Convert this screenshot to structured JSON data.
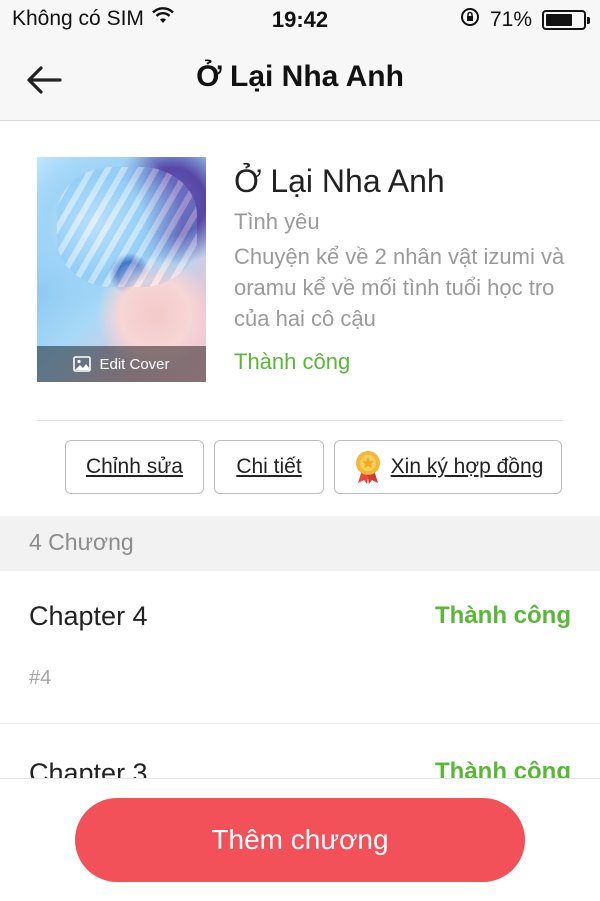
{
  "status_bar": {
    "carrier": "Không có SIM",
    "time": "19:42",
    "battery": "71%",
    "battery_level": 0.71
  },
  "nav": {
    "title": "Ở Lại Nha Anh"
  },
  "book": {
    "title": "Ở Lại Nha Anh",
    "genre": "Tình yêu",
    "description": "Chuyện kể về 2 nhân vật izumi và oramu kể về mối tình tuổi học tro của hai cô cậu",
    "status": "Thành công",
    "edit_cover_label": "Edit Cover"
  },
  "actions": {
    "edit_label": "Chỉnh sửa",
    "detail_label": "Chi tiết",
    "contract_label": "Xin ký hợp đồng"
  },
  "chapters_header": "4 Chương",
  "chapters": [
    {
      "title": "Chapter 4",
      "status": "Thành công",
      "number": "#4"
    },
    {
      "title": "Chapter 3",
      "status": "Thành công"
    }
  ],
  "add_chapter_label": "Thêm chương",
  "colors": {
    "accent": "#f2515a",
    "success": "#5ab738"
  }
}
